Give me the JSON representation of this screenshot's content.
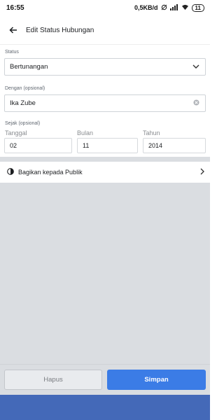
{
  "status_bar": {
    "time": "16:55",
    "net_speed": "0,5KB/d",
    "battery": "11"
  },
  "header": {
    "title": "Edit Status Hubungan"
  },
  "form": {
    "status_label": "Status",
    "status_value": "Bertunangan",
    "with_label": "Dengan (opsional)",
    "with_value": "Ika Zube",
    "since_label": "Sejak (opsional)",
    "date_headers": {
      "day": "Tanggal",
      "month": "Bulan",
      "year": "Tahun"
    },
    "date_values": {
      "day": "02",
      "month": "11",
      "year": "2014"
    }
  },
  "share": {
    "label": "Bagikan kepada Publik"
  },
  "actions": {
    "delete_label": "Hapus",
    "save_label": "Simpan"
  },
  "colors": {
    "accent": "#3b7ce6",
    "nav": "#4469b8",
    "panel": "#dadde1"
  },
  "icons": [
    "back-arrow-icon",
    "chevron-down-icon",
    "clear-icon",
    "globe-icon",
    "chevron-right-icon",
    "wifi-icon",
    "signal-icon",
    "sync-icon"
  ]
}
